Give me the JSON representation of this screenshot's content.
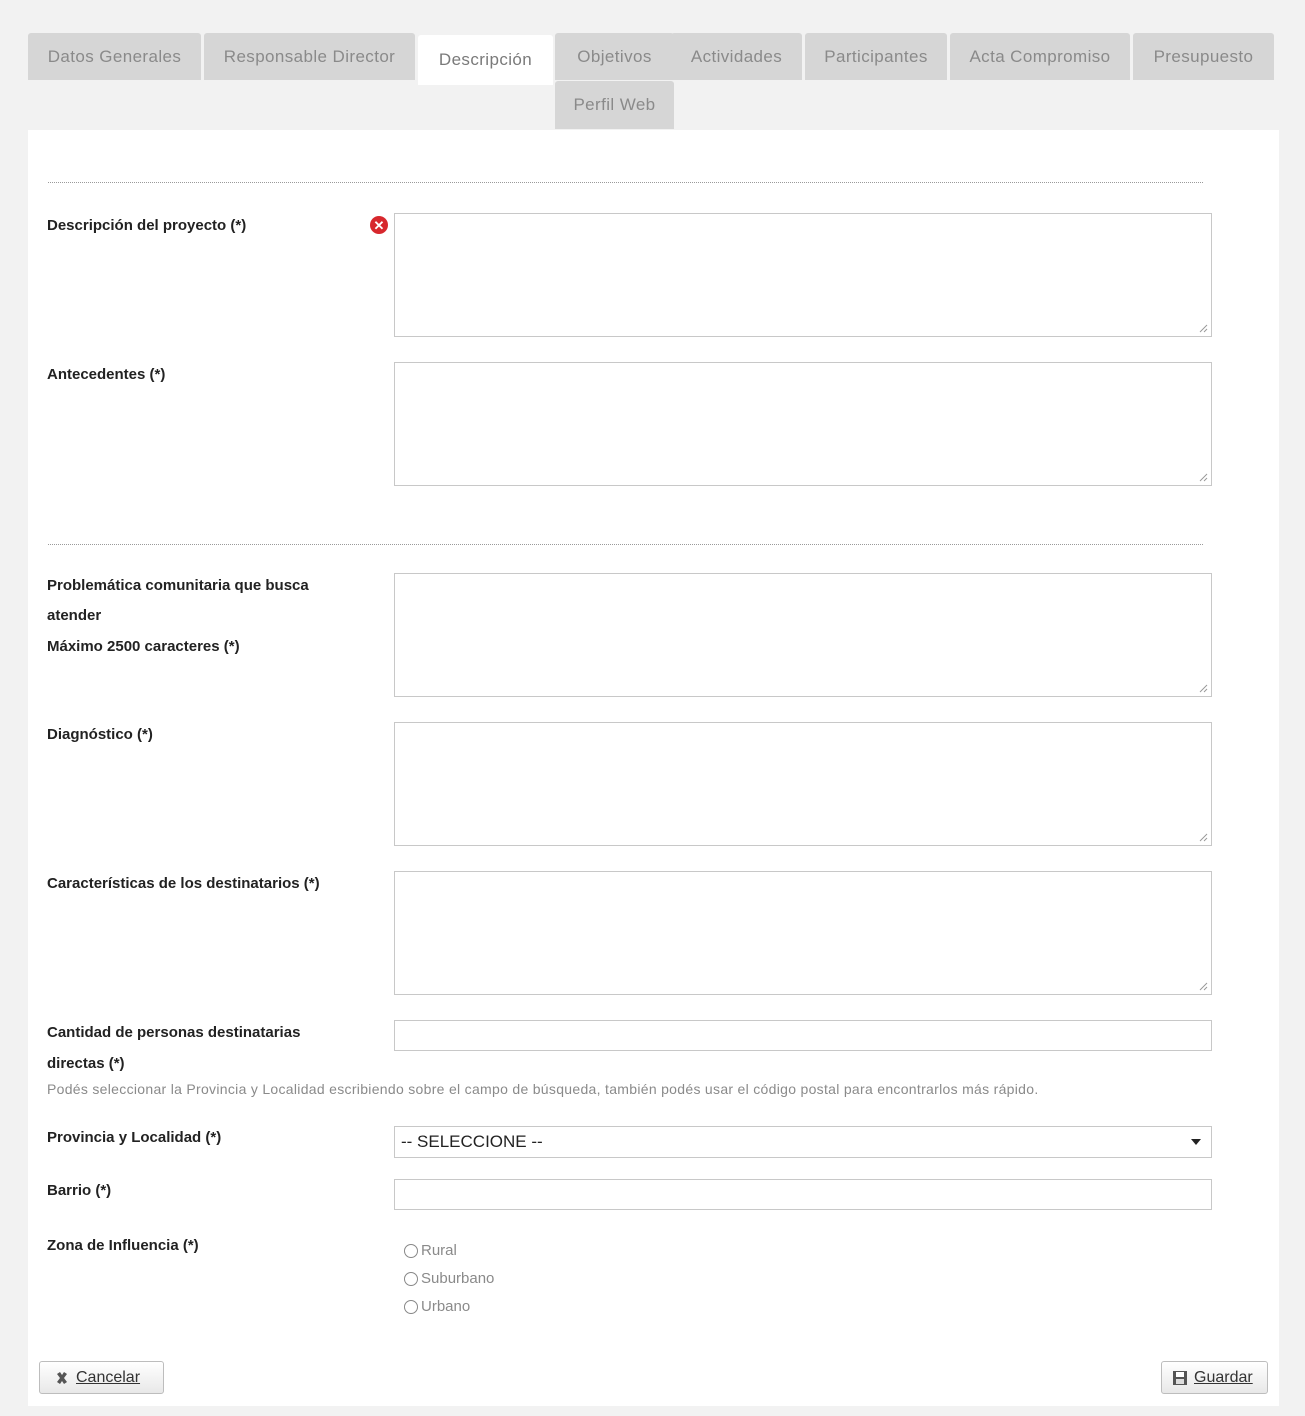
{
  "tabs": [
    {
      "label": "Datos Generales",
      "active": false
    },
    {
      "label": "Responsable Director",
      "active": false
    },
    {
      "label": "Descripción",
      "active": true
    },
    {
      "label": "Objetivos",
      "active": false
    },
    {
      "label": "Actividades",
      "active": false
    },
    {
      "label": "Participantes",
      "active": false
    },
    {
      "label": "Acta Compromiso",
      "active": false
    },
    {
      "label": "Presupuesto",
      "active": false
    },
    {
      "label": "Perfil Web",
      "active": false
    }
  ],
  "form": {
    "descripcion_label": "Descripción del proyecto (*)",
    "antecedentes_label": "Antecedentes (*)",
    "problematica_label_1": "Problemática comunitaria que busca",
    "problematica_label_2": "atender",
    "problematica_label_3": "Máximo 2500 caracteres (*)",
    "diagnostico_label": "Diagnóstico (*)",
    "caracteristicas_label": "Características de los destinatarios (*)",
    "cantidad_label_1": "Cantidad de personas destinatarias",
    "cantidad_label_2": "directas (*)",
    "hint": "Podés seleccionar la Provincia y Localidad escribiendo sobre el campo de búsqueda, también podés usar el código postal para encontrarlos más rápido.",
    "provincia_label": "Provincia y Localidad (*)",
    "provincia_value": "-- SELECCIONE --",
    "barrio_label": "Barrio (*)",
    "zona_label": "Zona de Influencia (*)",
    "zona_options": [
      "Rural",
      "Suburbano",
      "Urbano"
    ]
  },
  "buttons": {
    "cancel_label": "Cancelar",
    "save_label": "Guardar"
  },
  "icons": {
    "error": "error-icon",
    "cancel": "close-icon",
    "save": "floppy-disk-icon"
  },
  "colors": {
    "error": "#d7272d",
    "tab_bg": "#d6d6d6",
    "tab_text": "#8a8a8a"
  }
}
